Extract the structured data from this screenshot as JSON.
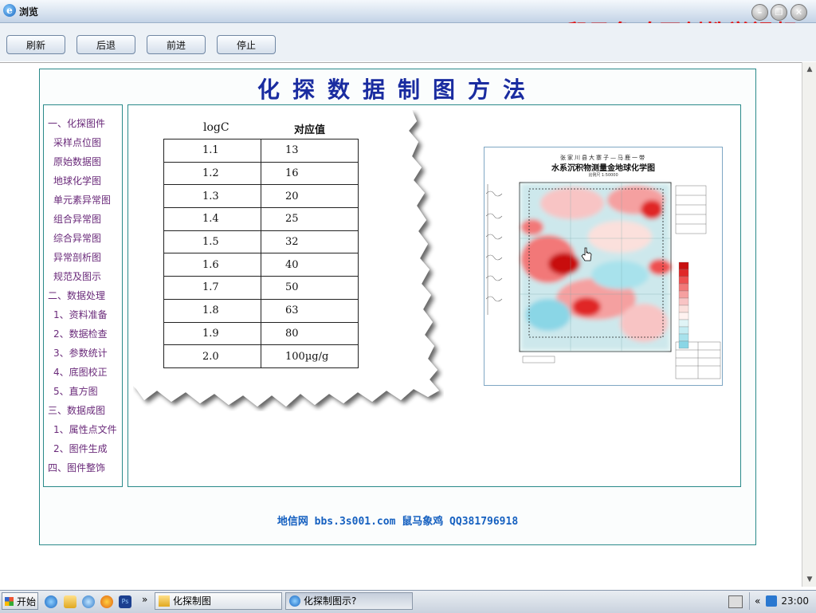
{
  "window": {
    "title": "浏览",
    "banner": "鼠马象鸡原创教学视频"
  },
  "toolbar": {
    "refresh": "刷新",
    "back": "后退",
    "forward": "前进",
    "stop": "停止"
  },
  "page": {
    "title": "化探数据制图方法",
    "footer": "地信网 bbs.3s001.com 鼠马象鸡 QQ381796918"
  },
  "nav": [
    {
      "label": "一、化探图件",
      "level": 1
    },
    {
      "label": "采样点位图",
      "level": 2
    },
    {
      "label": "原始数据图",
      "level": 2
    },
    {
      "label": "地球化学图",
      "level": 2
    },
    {
      "label": "单元素异常图",
      "level": 2
    },
    {
      "label": "组合异常图",
      "level": 2
    },
    {
      "label": "综合异常图",
      "level": 2
    },
    {
      "label": "异常剖析图",
      "level": 2
    },
    {
      "label": "规范及图示",
      "level": 2
    },
    {
      "label": "二、数据处理",
      "level": 1
    },
    {
      "label": "1、资料准备",
      "level": 3
    },
    {
      "label": "2、数据检查",
      "level": 3
    },
    {
      "label": "3、参数统计",
      "level": 3
    },
    {
      "label": "4、底图校正",
      "level": 3
    },
    {
      "label": "5、直方图",
      "level": 3
    },
    {
      "label": "三、数据成图",
      "level": 1
    },
    {
      "label": "1、属性点文件",
      "level": 3
    },
    {
      "label": "2、图件生成",
      "level": 3
    },
    {
      "label": "四、图件整饰",
      "level": 1
    }
  ],
  "table": {
    "headers": [
      "logC",
      "对应值"
    ],
    "rows": [
      [
        "1.1",
        "13"
      ],
      [
        "1.2",
        "16"
      ],
      [
        "1.3",
        "20"
      ],
      [
        "1.4",
        "25"
      ],
      [
        "1.5",
        "32"
      ],
      [
        "1.6",
        "40"
      ],
      [
        "1.7",
        "50"
      ],
      [
        "1.8",
        "63"
      ],
      [
        "1.9",
        "80"
      ],
      [
        "2.0",
        "100µg/g"
      ]
    ]
  },
  "map": {
    "title_line1": "张家川县大寨子—马鹿一带",
    "title_line2": "水系沉积物测量金地球化学图",
    "scale": "比例尺 1:50000",
    "legend_colors": [
      "#c81010",
      "#e02828",
      "#ee5050",
      "#f27878",
      "#f5a0a0",
      "#f8c4c4",
      "#fbe0dc",
      "#fff2f0",
      "#e0f4f6",
      "#c4ecf2",
      "#a8e2ec",
      "#8ad6e6"
    ]
  },
  "taskbar": {
    "start": "开始",
    "tasks": [
      {
        "label": "化探制图",
        "active": false
      },
      {
        "label": "化探制图示?",
        "active": true
      }
    ],
    "clock": "23:00",
    "chevron": "»"
  },
  "colors": {
    "title_blue": "#1a2ca0",
    "nav_purple": "#6a2a7a",
    "frame_teal": "#2a8a8a",
    "banner_red": "#e01010"
  }
}
